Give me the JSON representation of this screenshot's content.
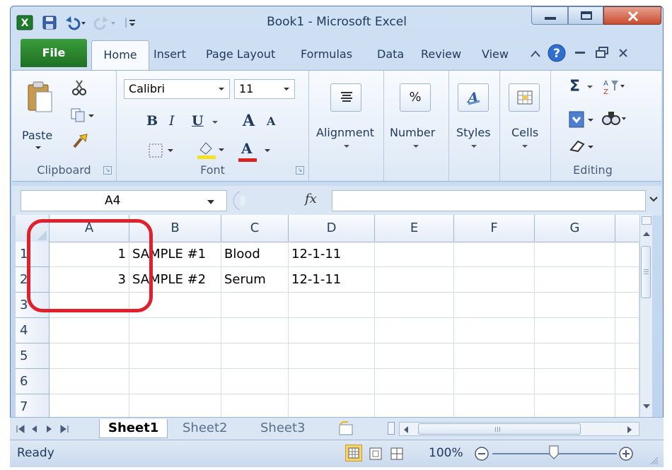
{
  "window": {
    "title": "Book1 - Microsoft Excel"
  },
  "tabs": {
    "file": "File",
    "items": [
      "Home",
      "Insert",
      "Page Layout",
      "Formulas",
      "Data",
      "Review",
      "View"
    ]
  },
  "ribbon": {
    "clipboard": {
      "paste": "Paste",
      "label": "Clipboard"
    },
    "font": {
      "name": "Calibri",
      "size": "11",
      "bold": "B",
      "italic": "I",
      "underline": "U",
      "grow": "A",
      "shrink": "A",
      "color": "A",
      "label": "Font"
    },
    "alignment": {
      "label": "Alignment"
    },
    "number": {
      "symbol": "%",
      "label": "Number"
    },
    "styles": {
      "label": "Styles"
    },
    "cells": {
      "label": "Cells"
    },
    "editing": {
      "sigma": "Σ",
      "label": "Editing"
    }
  },
  "formula_bar": {
    "name_box": "A4",
    "fx": "fx",
    "content": ""
  },
  "grid": {
    "columns": [
      "A",
      "B",
      "C",
      "D",
      "E",
      "F",
      "G"
    ],
    "rows": [
      {
        "num": "1",
        "A": "1",
        "B": "SAMPLE #1",
        "C": "Blood",
        "D": "12-1-11"
      },
      {
        "num": "2",
        "A": "3",
        "B": "SAMPLE #2",
        "C": "Serum",
        "D": "12-1-11"
      },
      {
        "num": "3",
        "A": "",
        "B": "",
        "C": "",
        "D": ""
      },
      {
        "num": "4",
        "A": "",
        "B": "",
        "C": "",
        "D": ""
      },
      {
        "num": "5",
        "A": "",
        "B": "",
        "C": "",
        "D": ""
      },
      {
        "num": "6",
        "A": "",
        "B": "",
        "C": "",
        "D": ""
      },
      {
        "num": "7",
        "A": "",
        "B": "",
        "C": "",
        "D": ""
      }
    ]
  },
  "sheets": [
    "Sheet1",
    "Sheet2",
    "Sheet3"
  ],
  "active_sheet": "Sheet1",
  "status": {
    "ready": "Ready",
    "zoom": "100%"
  },
  "colors": {
    "file_tab": "#2a8a2e",
    "annotation": "#e0202a",
    "close_button": "#c94b2f"
  }
}
